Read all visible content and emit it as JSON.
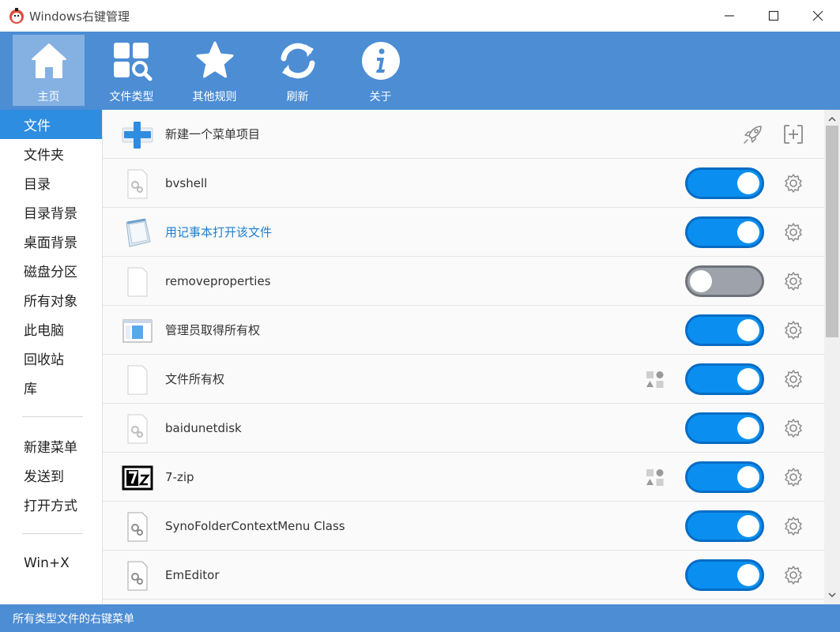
{
  "window": {
    "title": "Windows右键管理",
    "controls": [
      "minimize-icon",
      "maximize-icon",
      "close-icon"
    ]
  },
  "toolbar": {
    "items": [
      {
        "label": "主页",
        "icon": "home-icon",
        "active": true
      },
      {
        "label": "文件类型",
        "icon": "file-type-search-icon",
        "active": false
      },
      {
        "label": "其他规则",
        "icon": "star-icon",
        "active": false
      },
      {
        "label": "刷新",
        "icon": "refresh-icon",
        "active": false
      },
      {
        "label": "关于",
        "icon": "info-icon",
        "active": false
      }
    ]
  },
  "sidebar": {
    "group1": [
      "文件",
      "文件夹",
      "目录",
      "目录背景",
      "桌面背景",
      "磁盘分区",
      "所有对象",
      "此电脑",
      "回收站",
      "库"
    ],
    "group2": [
      "新建菜单",
      "发送到",
      "打开方式"
    ],
    "group3": [
      "Win+X"
    ],
    "active": "文件"
  },
  "list": {
    "new_item_label": "新建一个菜单项目",
    "rows": [
      {
        "label": "bvshell",
        "icon": "gear-document-icon",
        "enabled": true,
        "shapes": false,
        "link": false
      },
      {
        "label": "用记事本打开该文件",
        "icon": "notepad-icon",
        "enabled": true,
        "shapes": false,
        "link": true
      },
      {
        "label": "removeproperties",
        "icon": "blank-document-icon",
        "enabled": false,
        "shapes": false,
        "link": false
      },
      {
        "label": "管理员取得所有权",
        "icon": "window-icon",
        "enabled": true,
        "shapes": false,
        "link": false
      },
      {
        "label": "文件所有权",
        "icon": "blank-document-icon",
        "enabled": true,
        "shapes": true,
        "link": false
      },
      {
        "label": "baidunetdisk",
        "icon": "gear-document-icon",
        "enabled": true,
        "shapes": false,
        "link": false
      },
      {
        "label": "7-zip",
        "icon": "7zip-icon",
        "enabled": true,
        "shapes": true,
        "link": false
      },
      {
        "label": "SynoFolderContextMenu Class",
        "icon": "gear-document-icon",
        "enabled": true,
        "shapes": false,
        "link": false
      },
      {
        "label": "EmEditor",
        "icon": "gear-document-icon",
        "enabled": true,
        "shapes": false,
        "link": false
      }
    ]
  },
  "status": {
    "text": "所有类型文件的右键菜单"
  }
}
